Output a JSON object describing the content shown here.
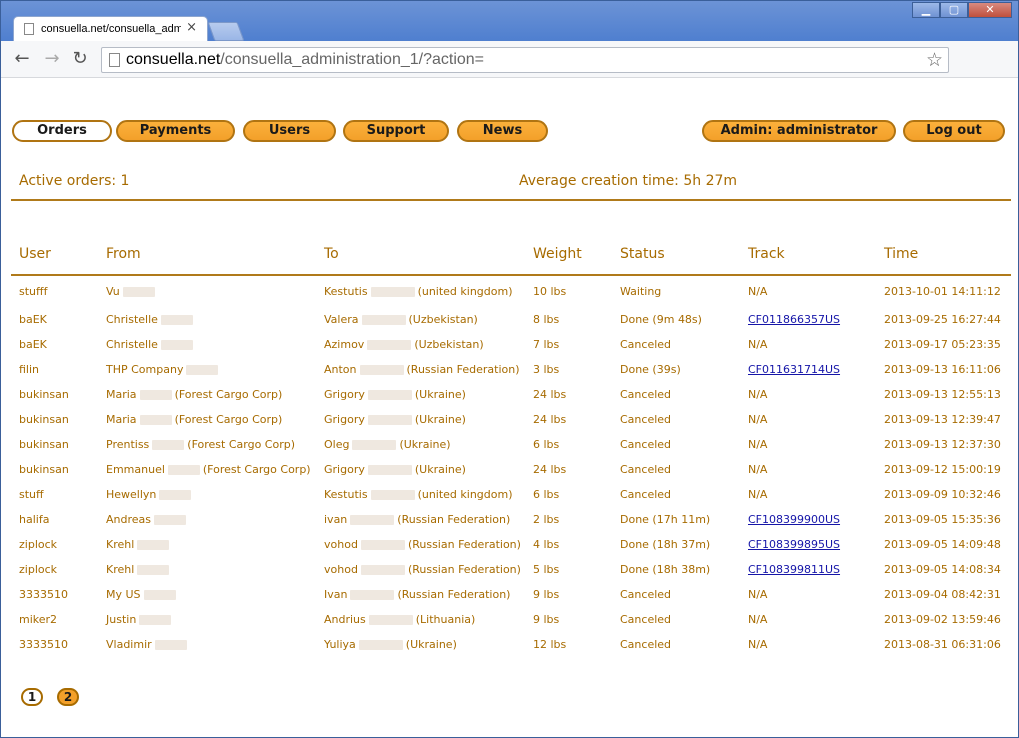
{
  "browser": {
    "tab_title": "consuella.net/consuella_adm",
    "url_domain": "consuella.net",
    "url_path": "/consuella_administration_1/?action="
  },
  "nav": {
    "orders": "Orders",
    "payments": "Payments",
    "users": "Users",
    "support": "Support",
    "news": "News",
    "admin": "Admin: administrator",
    "logout": "Log out"
  },
  "stats": {
    "active_orders": "Active orders: 1",
    "avg_time": "Average creation time: 5h 27m"
  },
  "table": {
    "headers": [
      "User",
      "From",
      "To",
      "Weight",
      "Status",
      "Track",
      "Time"
    ],
    "rows": [
      {
        "user": "stufff",
        "from": "Vu",
        "from_extra": "",
        "to": "Kestutis",
        "to_extra": "(united kingdom)",
        "weight": "10 lbs",
        "status": "Waiting",
        "track": "N/A",
        "link": false,
        "time": "2013-10-01 14:11:12"
      },
      {
        "user": "baEK",
        "from": "Christelle",
        "from_extra": "",
        "to": "Valera",
        "to_extra": "(Uzbekistan)",
        "weight": "8 lbs",
        "status": "Done (9m 48s)",
        "track": "CF011866357US",
        "link": true,
        "time": "2013-09-25 16:27:44"
      },
      {
        "user": "baEK",
        "from": "Christelle",
        "from_extra": "",
        "to": "Azimov",
        "to_extra": "(Uzbekistan)",
        "weight": "7 lbs",
        "status": "Canceled",
        "track": "N/A",
        "link": false,
        "time": "2013-09-17 05:23:35"
      },
      {
        "user": "filin",
        "from": "THP Company",
        "from_extra": "",
        "to": "Anton",
        "to_extra": "(Russian Federation)",
        "weight": "3 lbs",
        "status": "Done (39s)",
        "track": "CF011631714US",
        "link": true,
        "time": "2013-09-13 16:11:06"
      },
      {
        "user": "bukinsan",
        "from": "Maria",
        "from_extra": "(Forest Cargo Corp)",
        "to": "Grigory",
        "to_extra": "(Ukraine)",
        "weight": "24 lbs",
        "status": "Canceled",
        "track": "N/A",
        "link": false,
        "time": "2013-09-13 12:55:13"
      },
      {
        "user": "bukinsan",
        "from": "Maria",
        "from_extra": "(Forest Cargo Corp)",
        "to": "Grigory",
        "to_extra": "(Ukraine)",
        "weight": "24 lbs",
        "status": "Canceled",
        "track": "N/A",
        "link": false,
        "time": "2013-09-13 12:39:47"
      },
      {
        "user": "bukinsan",
        "from": "Prentiss",
        "from_extra": "(Forest Cargo Corp)",
        "to": "Oleg",
        "to_extra": "(Ukraine)",
        "weight": "6 lbs",
        "status": "Canceled",
        "track": "N/A",
        "link": false,
        "time": "2013-09-13 12:37:30"
      },
      {
        "user": "bukinsan",
        "from": "Emmanuel",
        "from_extra": "(Forest Cargo Corp)",
        "to": "Grigory",
        "to_extra": "(Ukraine)",
        "weight": "24 lbs",
        "status": "Canceled",
        "track": "N/A",
        "link": false,
        "time": "2013-09-12 15:00:19"
      },
      {
        "user": "stuff",
        "from": "Hewellyn",
        "from_extra": "",
        "to": "Kestutis",
        "to_extra": "(united kingdom)",
        "weight": "6 lbs",
        "status": "Canceled",
        "track": "N/A",
        "link": false,
        "time": "2013-09-09 10:32:46"
      },
      {
        "user": "halifa",
        "from": "Andreas",
        "from_extra": "",
        "to": "ivan",
        "to_extra": "(Russian Federation)",
        "weight": "2 lbs",
        "status": "Done (17h 11m)",
        "track": "CF108399900US",
        "link": true,
        "time": "2013-09-05 15:35:36"
      },
      {
        "user": "ziplock",
        "from": "Krehl",
        "from_extra": "",
        "to": "vohod",
        "to_extra": "(Russian Federation)",
        "weight": "4 lbs",
        "status": "Done (18h 37m)",
        "track": "CF108399895US",
        "link": true,
        "time": "2013-09-05 14:09:48"
      },
      {
        "user": "ziplock",
        "from": "Krehl",
        "from_extra": "",
        "to": "vohod",
        "to_extra": "(Russian Federation)",
        "weight": "5 lbs",
        "status": "Done (18h 38m)",
        "track": "CF108399811US",
        "link": true,
        "time": "2013-09-05 14:08:34"
      },
      {
        "user": "3333510",
        "from": "My US",
        "from_extra": "",
        "to": "Ivan",
        "to_extra": "(Russian Federation)",
        "weight": "9 lbs",
        "status": "Canceled",
        "track": "N/A",
        "link": false,
        "time": "2013-09-04 08:42:31"
      },
      {
        "user": "miker2",
        "from": "Justin",
        "from_extra": "",
        "to": "Andrius",
        "to_extra": "(Lithuania)",
        "weight": "9 lbs",
        "status": "Canceled",
        "track": "N/A",
        "link": false,
        "time": "2013-09-02 13:59:46"
      },
      {
        "user": "3333510",
        "from": "Vladimir",
        "from_extra": "",
        "to": "Yuliya",
        "to_extra": "(Ukraine)",
        "weight": "12 lbs",
        "status": "Canceled",
        "track": "N/A",
        "link": false,
        "time": "2013-08-31 06:31:06"
      }
    ]
  },
  "pager": [
    "1",
    "2"
  ],
  "colors": {
    "accent": "#f3a02a",
    "text": "#a76b00",
    "link": "#1515a8",
    "rule": "#b07a1a"
  }
}
